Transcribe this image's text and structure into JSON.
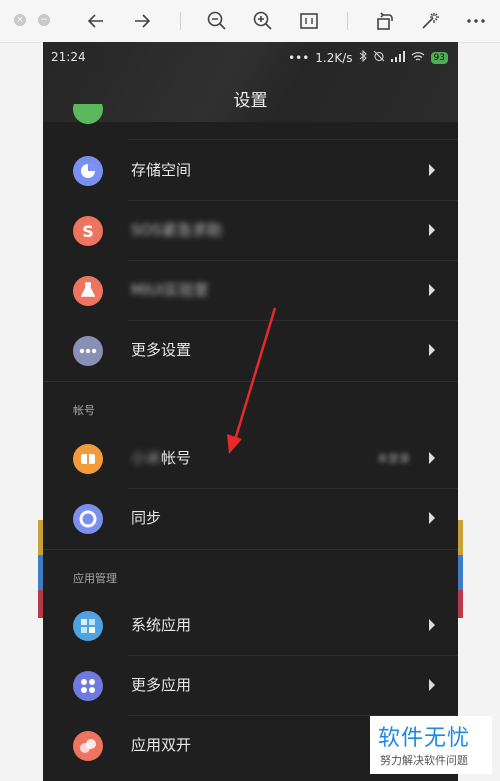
{
  "viewer": {
    "icons": [
      "close-icon",
      "minimize-icon",
      "back-arrow-icon",
      "forward-arrow-icon",
      "zoom-out-icon",
      "zoom-in-icon",
      "fit-icon",
      "rotate-icon",
      "magic-wand-icon",
      "more-icon"
    ]
  },
  "status_bar": {
    "time": "21:24",
    "dots": "•••",
    "speed": "1.2K/s",
    "battery": "93"
  },
  "header": {
    "title": "设置"
  },
  "items_top": [
    {
      "label": "存储空间",
      "icon": "storage-icon",
      "color": "#7b8ff0"
    },
    {
      "label": "SOS紧急求助",
      "icon": "sos-icon",
      "color": "#ec7460",
      "blurred": true
    },
    {
      "label": "MIUI实验室",
      "icon": "flask-icon",
      "color": "#ec7460",
      "blurred": true
    },
    {
      "label": "更多设置",
      "icon": "more-settings-icon",
      "color": "#8a8fb5"
    }
  ],
  "section_account": {
    "label": "帐号"
  },
  "items_account": [
    {
      "label_blur": "小米",
      "label": "帐号",
      "value": "未登录",
      "icon": "mi-account-icon",
      "color": "#f39a3b"
    },
    {
      "label": "同步",
      "icon": "sync-icon",
      "color": "#7b8ff0"
    }
  ],
  "section_apps": {
    "label": "应用管理"
  },
  "items_apps": [
    {
      "label": "系统应用",
      "icon": "system-apps-icon",
      "color": "#4fa3e0"
    },
    {
      "label": "更多应用",
      "icon": "more-apps-icon",
      "color": "#6f79e0"
    },
    {
      "label": "应用双开",
      "icon": "dual-apps-icon",
      "color": "#ec7460"
    }
  ],
  "watermark": {
    "main": "软件无忧",
    "sub": "努力解决软件问题"
  },
  "colors": {
    "annotation_arrow": "#e8292c",
    "battery": "#4caf50"
  }
}
